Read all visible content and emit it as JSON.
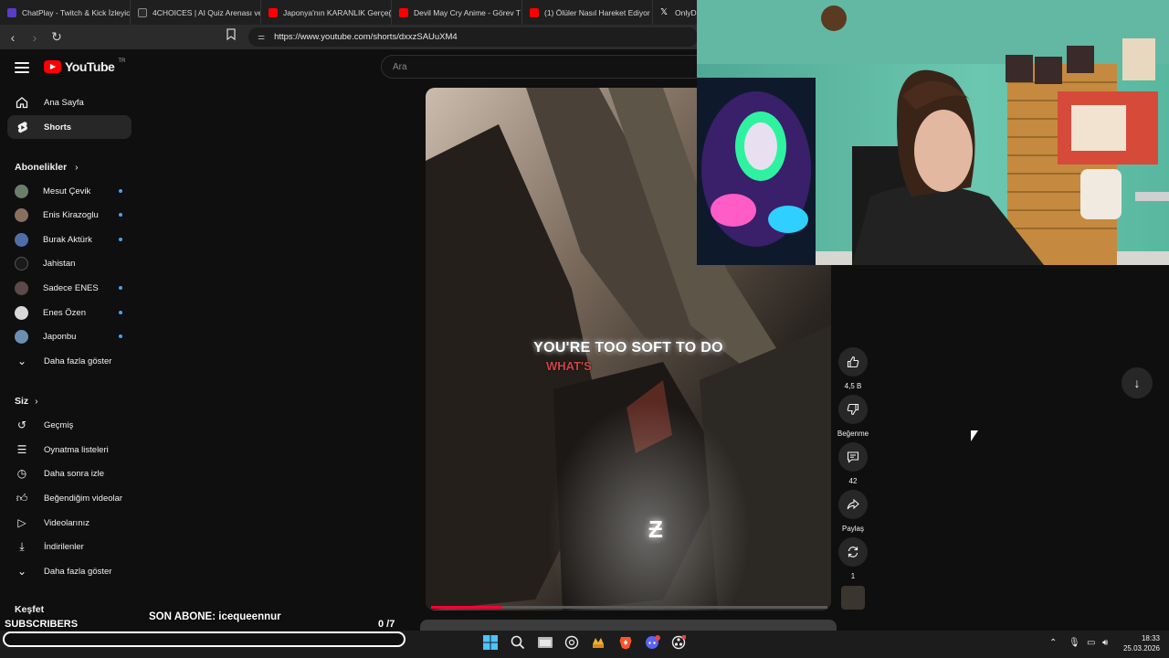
{
  "browser": {
    "tabs": [
      {
        "label": "ChatPlay - Twitch & Kick İzleyic",
        "favicon": "chatplay"
      },
      {
        "label": "4CHOICES | AI Quiz Arenası ve",
        "favicon": "4choices"
      },
      {
        "label": "Japonya'nın KARANLIK Gerçeği",
        "favicon": "youtube"
      },
      {
        "label": "Devil May Cry Anime - Görev T",
        "favicon": "youtube"
      },
      {
        "label": "(1) Ölüler Nasıl Hareket Ediyor",
        "favicon": "youtube"
      },
      {
        "label": "OnlyDr",
        "favicon": "x"
      }
    ],
    "url": "https://www.youtube.com/shorts/dxxzSAUuXM4"
  },
  "youtube": {
    "logo_text": "YouTube",
    "region": "TR",
    "search_placeholder": "Ara"
  },
  "sidebar": {
    "main": [
      {
        "label": "Ana Sayfa",
        "icon": "home-icon"
      },
      {
        "label": "Shorts",
        "icon": "shorts-icon"
      }
    ],
    "subs_header": "Abonelikler",
    "subs": [
      {
        "label": "Mesut Çevik",
        "dot": true,
        "color": "#6a7f6a"
      },
      {
        "label": "Enis Kirazoglu",
        "dot": true,
        "color": "#8a6f5e"
      },
      {
        "label": "Burak Aktürk",
        "dot": true,
        "color": "#4f6ea8"
      },
      {
        "label": "Jahistan",
        "dot": false,
        "color": "#1a1a1a"
      },
      {
        "label": "Sadece ENES",
        "dot": true,
        "color": "#5a4a4a"
      },
      {
        "label": "Enes Özen",
        "dot": true,
        "color": "#d8d8d8"
      },
      {
        "label": "Japonbu",
        "dot": true,
        "color": "#6b8fb0"
      }
    ],
    "subs_more": "Daha fazla göster",
    "you_header": "Siz",
    "you": [
      {
        "label": "Geçmiş",
        "icon": "history-icon"
      },
      {
        "label": "Oynatma listeleri",
        "icon": "playlists-icon"
      },
      {
        "label": "Daha sonra izle",
        "icon": "watch-later-icon"
      },
      {
        "label": "Beğendiğim videolar",
        "icon": "liked-icon"
      },
      {
        "label": "Videolarınız",
        "icon": "your-videos-icon"
      },
      {
        "label": "İndirilenler",
        "icon": "downloads-icon"
      }
    ],
    "you_more": "Daha fazla göster",
    "explore_header": "Keşfet"
  },
  "short": {
    "caption_line1": "YOU'RE TOO SOFT TO DO",
    "caption_line2": "WHAT'S",
    "watermark": "Ƶ",
    "progress": 0.18
  },
  "actions": {
    "like_count": "4,5 B",
    "dislike_label": "Beğenme",
    "comment_count": "42",
    "share_label": "Paylaş",
    "remix_count": "1"
  },
  "overlay": {
    "subscribers_label": "SUBSCRIBERS",
    "last_sub": "SON ABONE: icequeennur",
    "count": "0 /7"
  },
  "taskbar": {
    "time": "18:33",
    "date": "25.03.2026"
  }
}
